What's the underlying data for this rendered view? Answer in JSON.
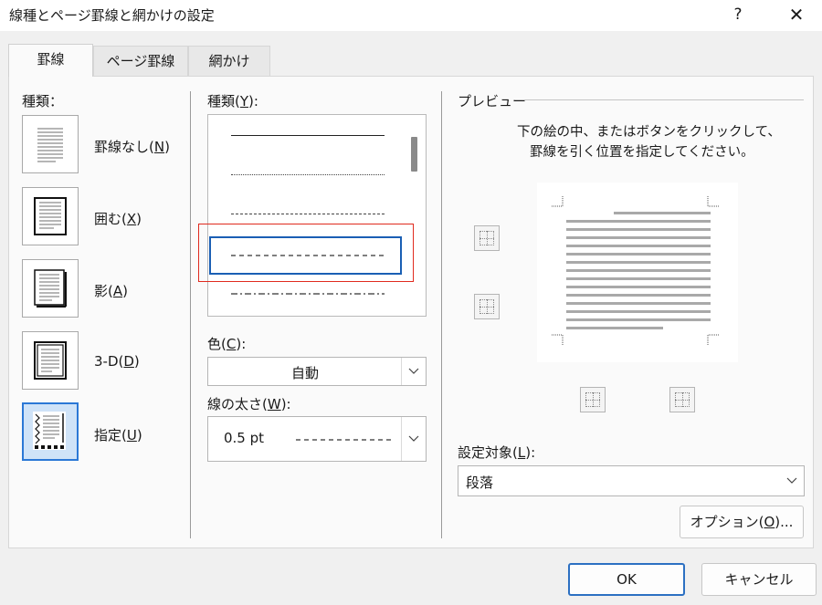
{
  "window": {
    "title": "線種とページ罫線と網かけの設定",
    "help": "?",
    "close": "✕"
  },
  "tabs": [
    {
      "label": "罫線",
      "active": true
    },
    {
      "label": "ページ罫線",
      "active": false
    },
    {
      "label": "網かけ",
      "active": false
    }
  ],
  "settings": {
    "heading": "種類：",
    "items": [
      {
        "label": "罫線なし(",
        "key": "N",
        "suffix": ")"
      },
      {
        "label": "囲む(",
        "key": "X",
        "suffix": ")"
      },
      {
        "label": "影(",
        "key": "A",
        "suffix": ")"
      },
      {
        "label": "3-D(",
        "key": "D",
        "suffix": ")"
      },
      {
        "label": "指定(",
        "key": "U",
        "suffix": ")"
      }
    ],
    "selected_index": 4
  },
  "style": {
    "heading_prefix": "種類(",
    "heading_key": "Y",
    "heading_suffix": "):",
    "options": [
      "solid",
      "dotted",
      "dashed-fine",
      "dashed",
      "dash-dot"
    ],
    "selected": "dashed"
  },
  "color": {
    "label_prefix": "色(",
    "label_key": "C",
    "label_suffix": "):",
    "value": "自動"
  },
  "width": {
    "label_prefix": "線の太さ(",
    "label_key": "W",
    "label_suffix": "):",
    "value": "0.5 pt"
  },
  "preview": {
    "heading": "プレビュー",
    "instruction_line1": "下の絵の中、またはボタンをクリックして、",
    "instruction_line2": "罫線を引く位置を指定してください。"
  },
  "apply_to": {
    "label_prefix": "設定対象(",
    "label_key": "L",
    "label_suffix": "):",
    "value": "段落"
  },
  "buttons": {
    "options_prefix": "オプション(",
    "options_key": "O",
    "options_suffix": ")...",
    "ok": "OK",
    "cancel": "キャンセル"
  },
  "colors": {
    "accent": "#2b78d6",
    "highlight": "#e02a1e"
  },
  "icons": [
    "help-icon",
    "close-icon",
    "chevron-down-icon",
    "border-top-icon",
    "border-bottom-icon",
    "border-left-icon",
    "border-right-icon"
  ]
}
